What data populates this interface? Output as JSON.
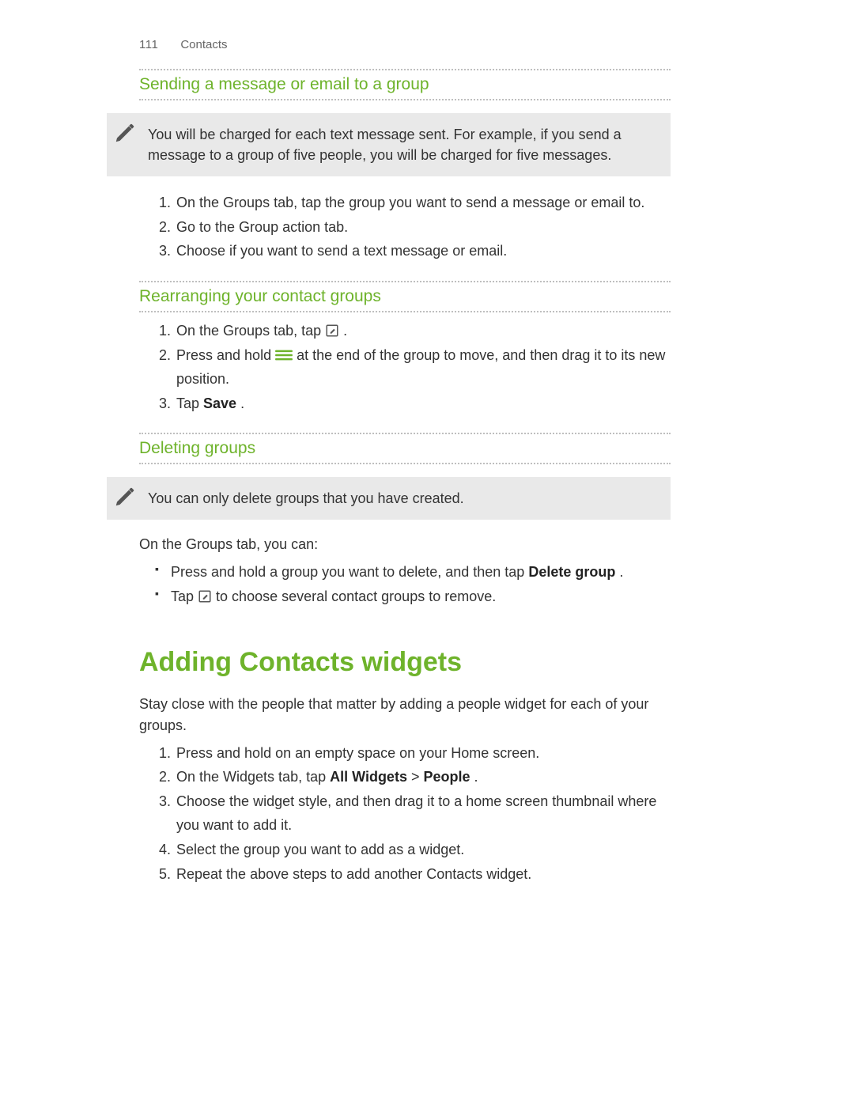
{
  "header": {
    "page_number": "111",
    "chapter": "Contacts"
  },
  "sec1": {
    "title": "Sending a message or email to a group",
    "note": "You will be charged for each text message sent. For example, if you send a message to a group of five people, you will be charged for five messages.",
    "steps": [
      "On the Groups tab, tap the group you want to send a message or email to.",
      "Go to the Group action tab.",
      "Choose if you want to send a text message or email."
    ]
  },
  "sec2": {
    "title": "Rearranging your contact groups",
    "step1_a": "On the Groups tab, tap ",
    "step1_b": ".",
    "step2_a": "Press and hold ",
    "step2_b": " at the end of the group to move, and then drag it to its new position.",
    "step3_a": "Tap ",
    "step3_bold": "Save",
    "step3_b": "."
  },
  "sec3": {
    "title": "Deleting groups",
    "note": "You can only delete groups that you have created.",
    "intro": "On the Groups tab, you can:",
    "bullet1_a": "Press and hold a group you want to delete, and then tap ",
    "bullet1_bold": "Delete group",
    "bullet1_b": ".",
    "bullet2_a": "Tap ",
    "bullet2_b": " to choose several contact groups to remove."
  },
  "sec4": {
    "title": "Adding Contacts widgets",
    "intro": "Stay close with the people that matter by adding a people widget for each of your groups.",
    "step1": "Press and hold on an empty space on your Home screen.",
    "step2_a": "On the Widgets tab, tap ",
    "step2_bold1": "All Widgets",
    "step2_mid": " > ",
    "step2_bold2": "People",
    "step2_b": ".",
    "step3": "Choose the widget style, and then drag it to a home screen thumbnail where you want to add it.",
    "step4": "Select the group you want to add as a widget.",
    "step5": "Repeat the above steps to add another Contacts widget."
  }
}
